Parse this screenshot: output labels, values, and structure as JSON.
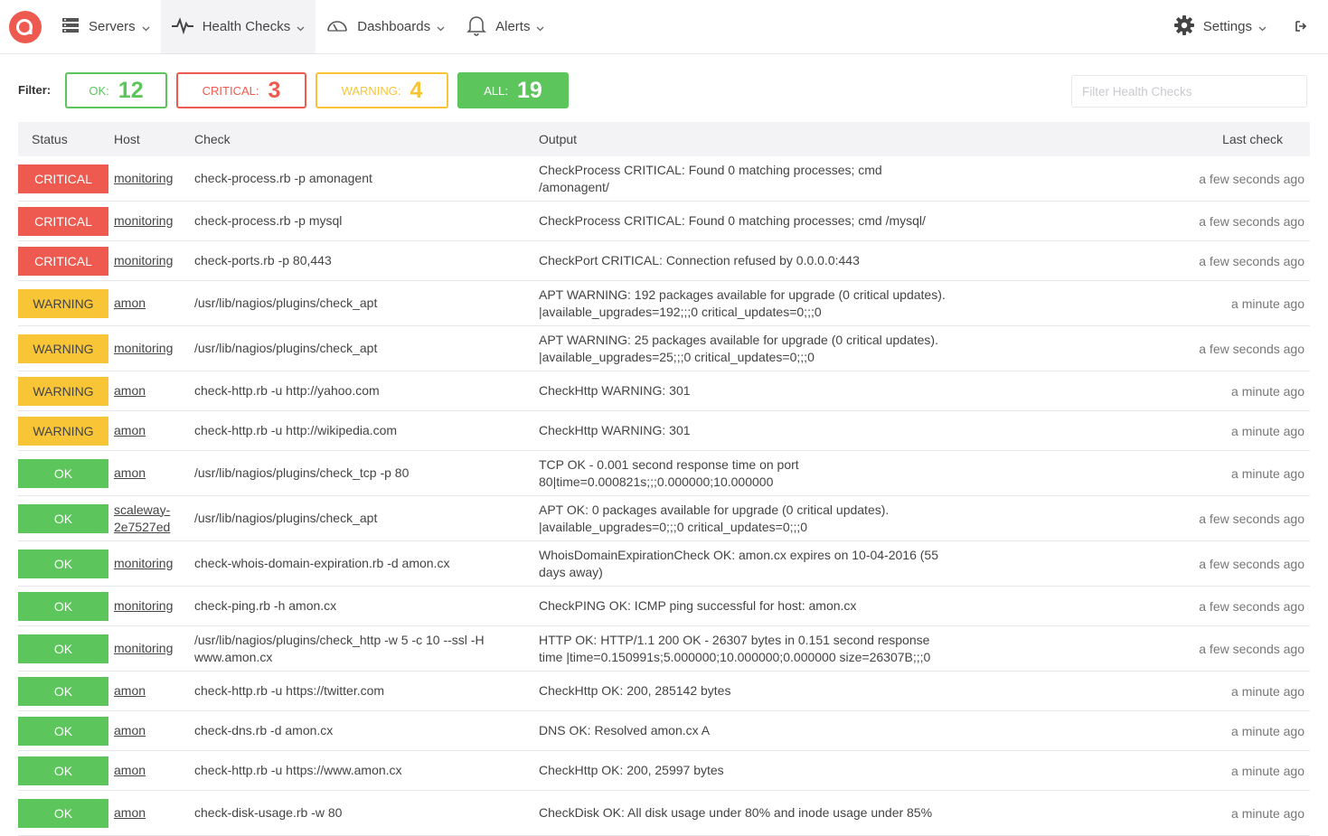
{
  "nav": {
    "items": [
      {
        "label": "Servers",
        "icon": "server-icon"
      },
      {
        "label": "Health Checks",
        "icon": "pulse-icon"
      },
      {
        "label": "Dashboards",
        "icon": "gauge-icon"
      },
      {
        "label": "Alerts",
        "icon": "bell-icon"
      }
    ],
    "settings_label": "Settings"
  },
  "filter": {
    "label": "Filter:",
    "ok_label": "OK:",
    "ok_count": "12",
    "critical_label": "CRITICAL:",
    "critical_count": "3",
    "warning_label": "WARNING:",
    "warning_count": "4",
    "all_label": "ALL:",
    "all_count": "19",
    "search_placeholder": "Filter Health Checks"
  },
  "colors": {
    "ok": "#5cc55c",
    "critical": "#ee5a4f",
    "warning": "#f8c537",
    "brand": "#ee5a4f"
  },
  "table": {
    "headers": {
      "status": "Status",
      "host": "Host",
      "check": "Check",
      "output": "Output",
      "last": "Last check"
    },
    "rows": [
      {
        "status": "CRITICAL",
        "host": "monitoring",
        "check": "check-process.rb -p amonagent",
        "output": "CheckProcess CRITICAL: Found 0 matching processes; cmd /amonagent/",
        "last": "a few seconds ago"
      },
      {
        "status": "CRITICAL",
        "host": "monitoring",
        "check": "check-process.rb -p mysql",
        "output": "CheckProcess CRITICAL: Found 0 matching processes; cmd /mysql/",
        "last": "a few seconds ago"
      },
      {
        "status": "CRITICAL",
        "host": "monitoring",
        "check": "check-ports.rb -p 80,443",
        "output": "CheckPort CRITICAL: Connection refused by 0.0.0.0:443",
        "last": "a few seconds ago"
      },
      {
        "status": "WARNING",
        "host": "amon",
        "check": "/usr/lib/nagios/plugins/check_apt",
        "output": "APT WARNING: 192 packages available for upgrade (0 critical updates). |available_upgrades=192;;;0 critical_updates=0;;;0",
        "last": "a minute ago"
      },
      {
        "status": "WARNING",
        "host": "monitoring",
        "check": "/usr/lib/nagios/plugins/check_apt",
        "output": "APT WARNING: 25 packages available for upgrade (0 critical updates). |available_upgrades=25;;;0 critical_updates=0;;;0",
        "last": "a few seconds ago"
      },
      {
        "status": "WARNING",
        "host": "amon",
        "check": "check-http.rb -u http://yahoo.com",
        "output": "CheckHttp WARNING: 301",
        "last": "a minute ago"
      },
      {
        "status": "WARNING",
        "host": "amon",
        "check": "check-http.rb -u http://wikipedia.com",
        "output": "CheckHttp WARNING: 301",
        "last": "a minute ago"
      },
      {
        "status": "OK",
        "host": "amon",
        "check": "/usr/lib/nagios/plugins/check_tcp -p 80",
        "output": "TCP OK - 0.001 second response time on port 80|time=0.000821s;;;0.000000;10.000000",
        "last": "a minute ago"
      },
      {
        "status": "OK",
        "host": "scaleway-2e7527ed",
        "check": "/usr/lib/nagios/plugins/check_apt",
        "output": "APT OK: 0 packages available for upgrade (0 critical updates). |available_upgrades=0;;;0 critical_updates=0;;;0",
        "last": "a few seconds ago"
      },
      {
        "status": "OK",
        "host": "monitoring",
        "check": "check-whois-domain-expiration.rb -d amon.cx",
        "output": "WhoisDomainExpirationCheck OK: amon.cx expires on 10-04-2016 (55 days away)",
        "last": "a few seconds ago"
      },
      {
        "status": "OK",
        "host": "monitoring",
        "check": "check-ping.rb -h amon.cx",
        "output": "CheckPING OK: ICMP ping successful for host: amon.cx",
        "last": "a few seconds ago"
      },
      {
        "status": "OK",
        "host": "monitoring",
        "check": "/usr/lib/nagios/plugins/check_http -w 5 -c 10 --ssl -H www.amon.cx",
        "output": "HTTP OK: HTTP/1.1 200 OK - 26307 bytes in 0.151 second response time |time=0.150991s;5.000000;10.000000;0.000000 size=26307B;;;0",
        "last": "a few seconds ago"
      },
      {
        "status": "OK",
        "host": "amon",
        "check": "check-http.rb -u https://twitter.com",
        "output": "CheckHttp OK: 200, 285142 bytes",
        "last": "a minute ago"
      },
      {
        "status": "OK",
        "host": "amon",
        "check": "check-dns.rb -d amon.cx",
        "output": "DNS OK: Resolved amon.cx A",
        "last": "a minute ago"
      },
      {
        "status": "OK",
        "host": "amon",
        "check": "check-http.rb -u https://www.amon.cx",
        "output": "CheckHttp OK: 200, 25997 bytes",
        "last": "a minute ago"
      },
      {
        "status": "OK",
        "host": "amon",
        "check": "check-disk-usage.rb -w 80",
        "output": "CheckDisk OK: All disk usage under 80% and inode usage under 85%",
        "last": "a minute ago"
      }
    ]
  }
}
